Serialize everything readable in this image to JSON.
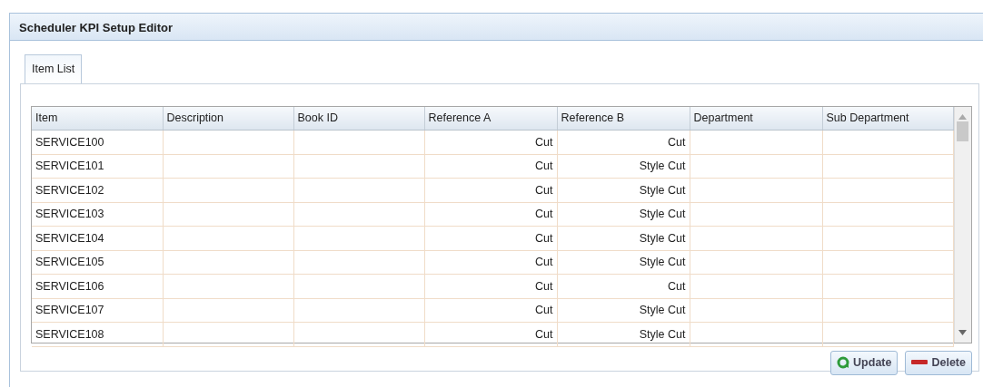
{
  "window": {
    "title": "Scheduler KPI Setup Editor"
  },
  "tabs": [
    {
      "label": "Item List",
      "selected": true
    }
  ],
  "table": {
    "columns": [
      "Item",
      "Description",
      "Book ID",
      "Reference A",
      "Reference B",
      "Department",
      "Sub Department"
    ],
    "rows": [
      {
        "item": "SERVICE100",
        "reference_a": "Cut",
        "reference_b": "Cut"
      },
      {
        "item": "SERVICE101",
        "reference_a": "Cut",
        "reference_b": "Style Cut"
      },
      {
        "item": "SERVICE102",
        "reference_a": "Cut",
        "reference_b": "Style Cut"
      },
      {
        "item": "SERVICE103",
        "reference_a": "Cut",
        "reference_b": "Style Cut"
      },
      {
        "item": "SERVICE104",
        "reference_a": "Cut",
        "reference_b": "Style Cut"
      },
      {
        "item": "SERVICE105",
        "reference_a": "Cut",
        "reference_b": "Style Cut"
      },
      {
        "item": "SERVICE106",
        "reference_a": "Cut",
        "reference_b": "Cut"
      },
      {
        "item": "SERVICE107",
        "reference_a": "Cut",
        "reference_b": "Style Cut"
      },
      {
        "item": "SERVICE108",
        "reference_a": "Cut",
        "reference_b": "Style Cut"
      }
    ]
  },
  "buttons": [
    {
      "kind": "update",
      "label": "Update"
    },
    {
      "kind": "delete",
      "label": "Delete"
    }
  ]
}
